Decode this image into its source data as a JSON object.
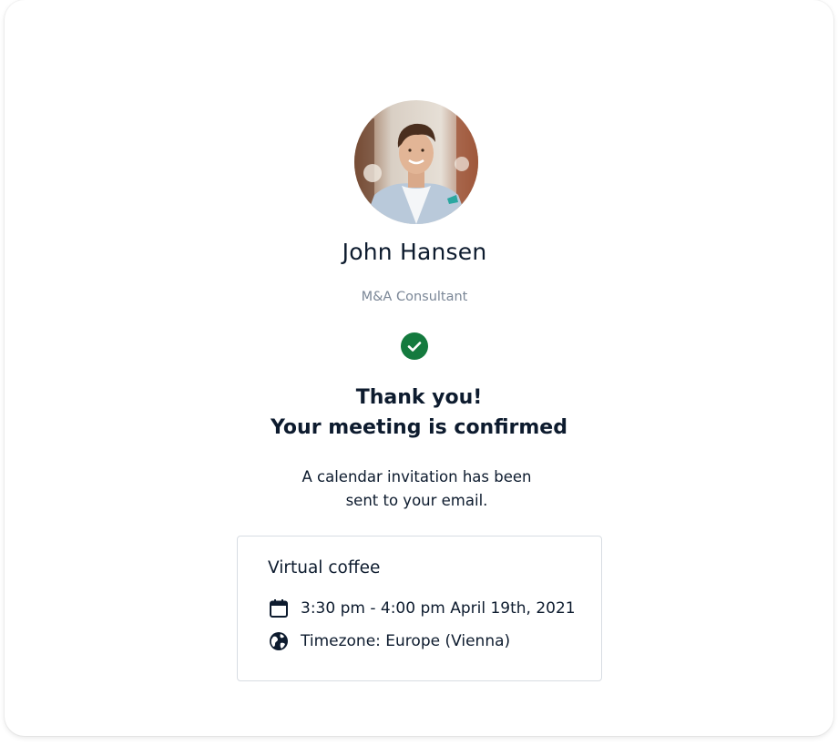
{
  "host": {
    "name": "John Hansen",
    "role": "M&A Consultant",
    "avatar_icon": "profile-photo"
  },
  "confirmation": {
    "status_icon": "check-circle-icon",
    "status_color": "#147a3e",
    "line1": "Thank you!",
    "line2": "Your meeting is confirmed",
    "message_line1": "A calendar invitation has been",
    "message_line2": "sent to your email."
  },
  "event": {
    "title": "Virtual coffee",
    "time": "3:30 pm - 4:00 pm April 19th, 2021",
    "time_icon": "calendar-icon",
    "timezone": "Timezone: Europe (Vienna)",
    "timezone_icon": "globe-icon"
  }
}
